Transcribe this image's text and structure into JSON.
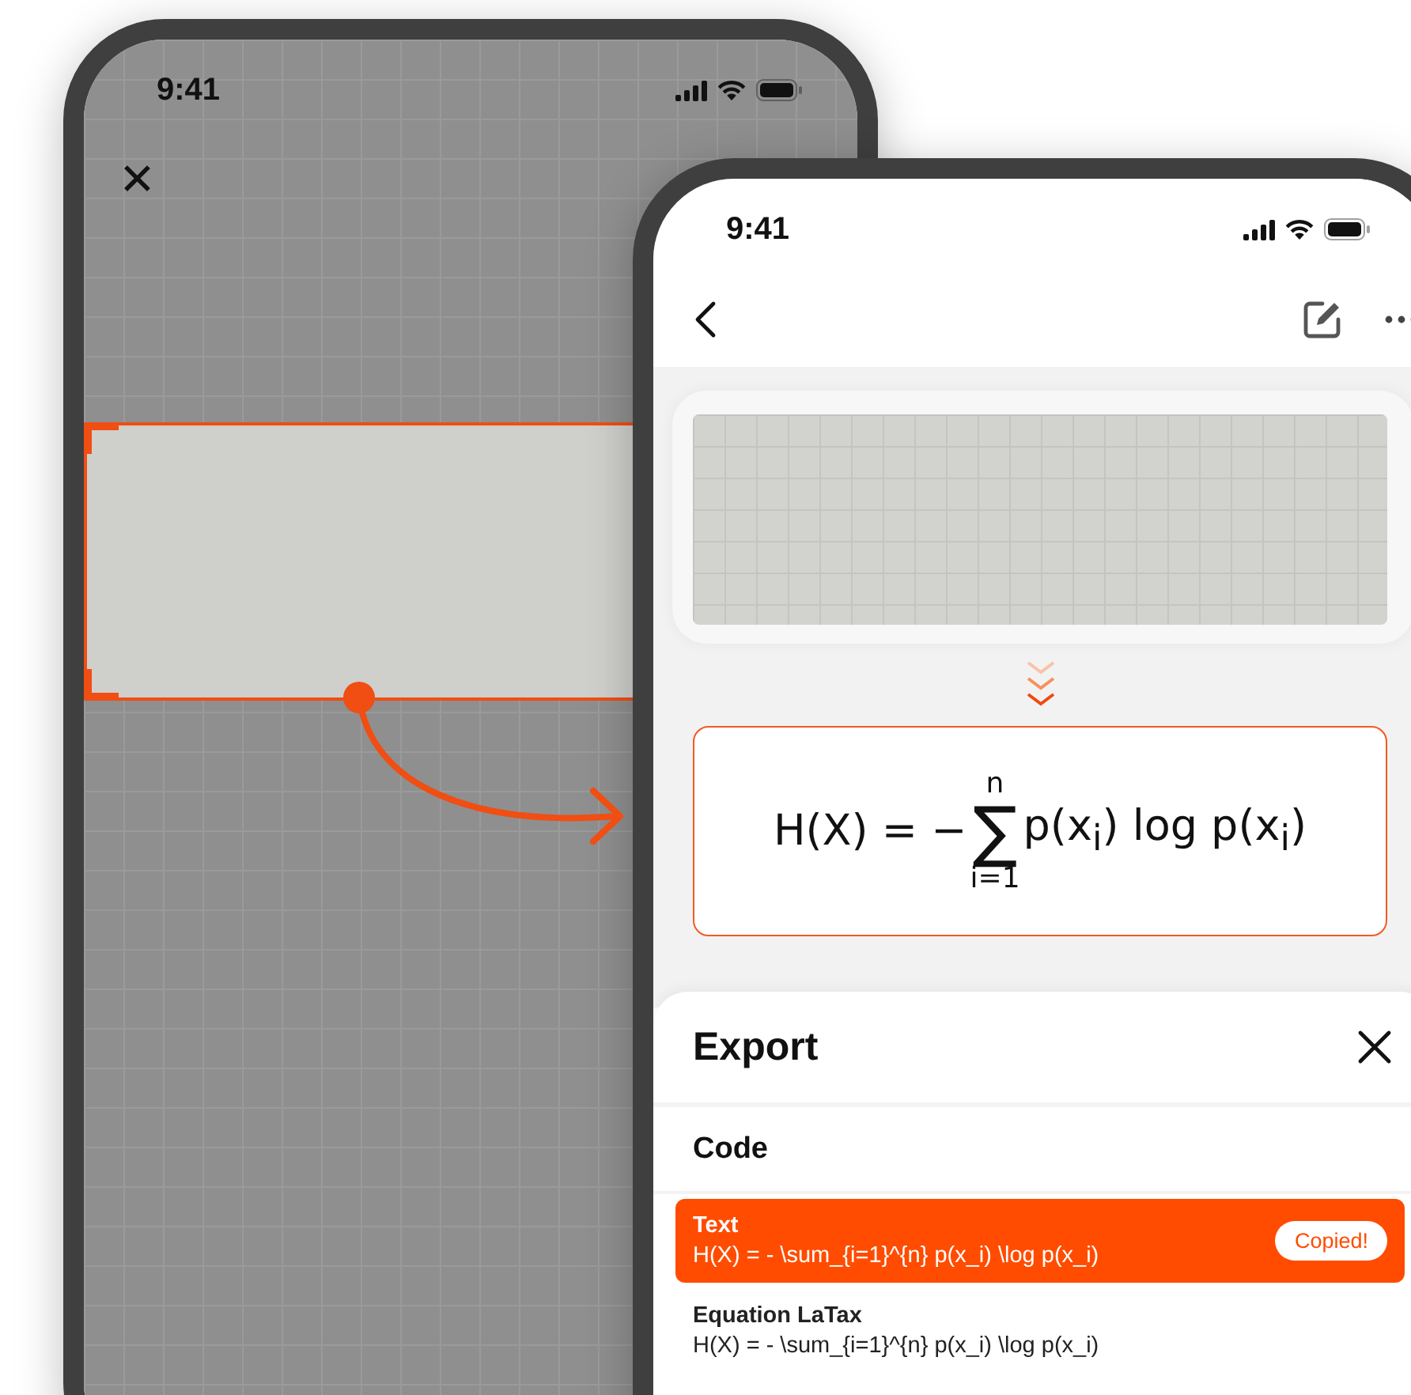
{
  "camera_screen": {
    "status_bar": {
      "time": "9:41"
    },
    "close_symbol": "✕"
  },
  "result_screen": {
    "status_bar": {
      "time": "9:41"
    },
    "formula": {
      "lhs": "H(X) = −",
      "sum_symbol": "∑",
      "upper_limit": "n",
      "lower_limit": "i=1",
      "rhs": "p(x$_{i}$) log p(x$_{i}$)"
    },
    "export_sheet": {
      "title": "Export",
      "section": "Code",
      "items": [
        {
          "title": "Text",
          "code": "H(X) = - \\sum_{i=1}^{n} p(x_i) \\log p(x_i)",
          "selected": true,
          "badge": "Copied!"
        },
        {
          "title": "Equation LaTax",
          "code": "H(X) = - \\sum_{i=1}^{n} p(x_i) \\log p(x_i)",
          "selected": false
        }
      ]
    }
  }
}
